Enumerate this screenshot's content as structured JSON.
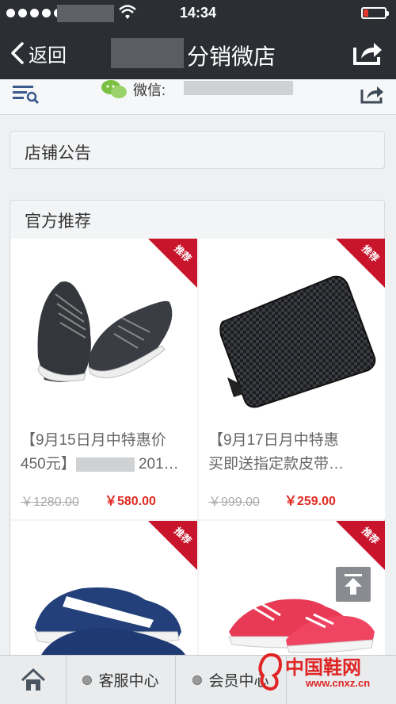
{
  "status": {
    "time": "14:34",
    "battery_level": 0.2
  },
  "nav": {
    "back_label": "返回",
    "title": "分销微店"
  },
  "subbar": {
    "wechat_label": "微信:"
  },
  "notice": {
    "title": "店铺公告"
  },
  "recommend": {
    "title": "官方推荐",
    "ribbon_label": "推荐",
    "products": [
      {
        "name_line1": "【9月15日月中特惠价",
        "name_line2_a": "450元】",
        "name_line2_b": "201…",
        "old_price": "￥1280.00",
        "new_price": "￥580.00",
        "image": "black-sneaker"
      },
      {
        "name_line1": "【9月17日月中特惠",
        "name_line2_a": "买即送指定款皮带…",
        "name_line2_b": "",
        "old_price": "￥999.00",
        "new_price": "￥259.00",
        "image": "black-woven-wallet"
      },
      {
        "image": "blue-sneaker"
      },
      {
        "image": "red-sneaker"
      }
    ]
  },
  "tabs": [
    {
      "label": "",
      "icon": "home-icon"
    },
    {
      "label": "客服中心",
      "icon": "dot-icon"
    },
    {
      "label": "会员中心",
      "icon": "dot-icon"
    },
    {
      "label": "",
      "icon": ""
    }
  ],
  "watermark": {
    "text": "中国鞋网",
    "url": "www.cnxz.cn"
  }
}
